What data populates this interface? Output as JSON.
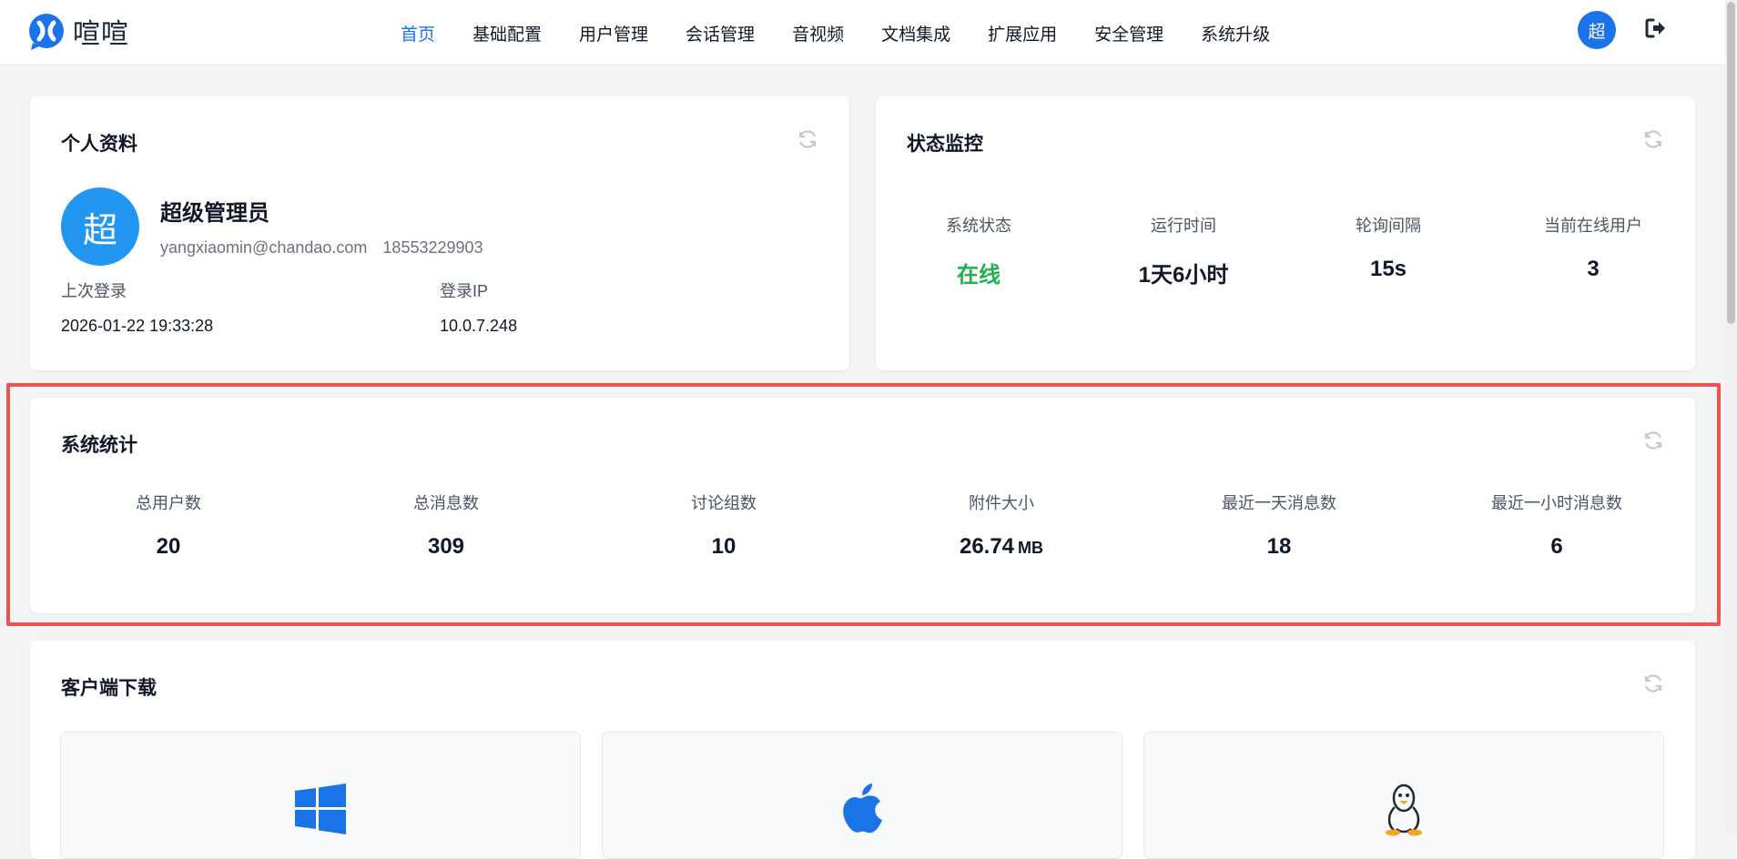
{
  "app": {
    "logo_text": "喧喧",
    "brand_color": "#1a73e8"
  },
  "nav": {
    "items": [
      {
        "label": "首页",
        "active": true
      },
      {
        "label": "基础配置",
        "active": false
      },
      {
        "label": "用户管理",
        "active": false
      },
      {
        "label": "会话管理",
        "active": false
      },
      {
        "label": "音视频",
        "active": false
      },
      {
        "label": "文档集成",
        "active": false
      },
      {
        "label": "扩展应用",
        "active": false
      },
      {
        "label": "安全管理",
        "active": false
      },
      {
        "label": "系统升级",
        "active": false
      }
    ],
    "user_avatar": "超",
    "logout_icon": "logout-icon"
  },
  "profile": {
    "title": "个人资料",
    "avatar": "超",
    "name": "超级管理员",
    "email": "yangxiaomin@chandao.com",
    "phone": "18553229903",
    "last_login_label": "上次登录",
    "last_login_value": "2026-01-22 19:33:28",
    "login_ip_label": "登录IP",
    "login_ip_value": "10.0.7.248",
    "refresh_icon": "refresh-icon"
  },
  "monitor": {
    "title": "状态监控",
    "stats": [
      {
        "label": "系统状态",
        "value": "在线",
        "status_color": "#22b14c"
      },
      {
        "label": "运行时间",
        "value": "1天6小时"
      },
      {
        "label": "轮询间隔",
        "value": "15s"
      },
      {
        "label": "当前在线用户",
        "value": "3"
      }
    ]
  },
  "system_stats": {
    "title": "系统统计",
    "highlight_color": "#ef5350",
    "stats": [
      {
        "label": "总用户数",
        "value": "20"
      },
      {
        "label": "总消息数",
        "value": "309"
      },
      {
        "label": "讨论组数",
        "value": "10"
      },
      {
        "label": "附件大小",
        "value": "26.74",
        "unit": "MB"
      },
      {
        "label": "最近一天消息数",
        "value": "18"
      },
      {
        "label": "最近一小时消息数",
        "value": "6"
      }
    ]
  },
  "downloads": {
    "title": "客户端下载",
    "platforms": [
      {
        "icon": "windows-icon"
      },
      {
        "icon": "apple-icon"
      },
      {
        "icon": "linux-icon"
      }
    ]
  }
}
